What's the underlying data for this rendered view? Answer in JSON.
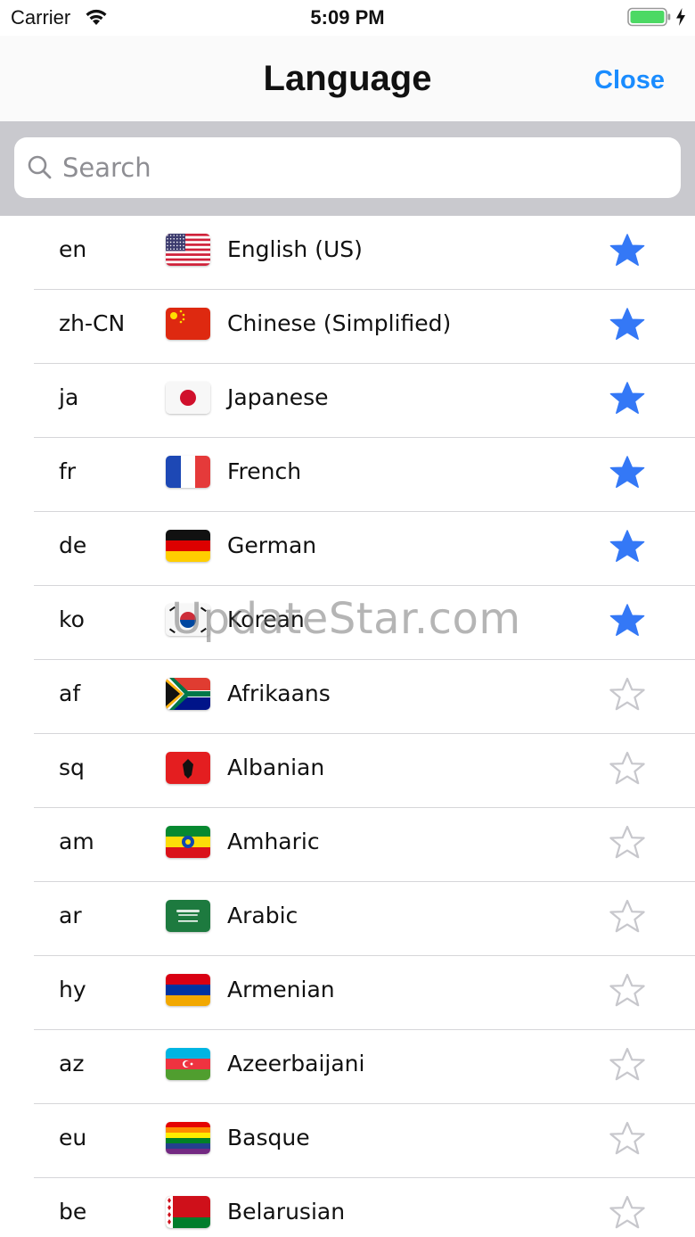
{
  "status_bar": {
    "carrier": "Carrier",
    "time": "5:09 PM",
    "battery_color": "#4cd964"
  },
  "nav": {
    "title": "Language",
    "close_label": "Close",
    "accent_color": "#1a8cff"
  },
  "search": {
    "placeholder": "Search",
    "value": ""
  },
  "star_colors": {
    "favorite": "#3478f6",
    "not_favorite": "#c7c7cc"
  },
  "languages": [
    {
      "code": "en",
      "name": "English (US)",
      "flag": "us-flag",
      "favorite": true
    },
    {
      "code": "zh-CN",
      "name": "Chinese (Simplified)",
      "flag": "cn-flag",
      "favorite": true
    },
    {
      "code": "ja",
      "name": "Japanese",
      "flag": "jp-flag",
      "favorite": true
    },
    {
      "code": "fr",
      "name": "French",
      "flag": "fr-flag",
      "favorite": true
    },
    {
      "code": "de",
      "name": "German",
      "flag": "de-flag",
      "favorite": true
    },
    {
      "code": "ko",
      "name": "Korean",
      "flag": "kr-flag",
      "favorite": true
    },
    {
      "code": "af",
      "name": "Afrikaans",
      "flag": "za-flag",
      "favorite": false
    },
    {
      "code": "sq",
      "name": "Albanian",
      "flag": "al-flag",
      "favorite": false
    },
    {
      "code": "am",
      "name": "Amharic",
      "flag": "et-flag",
      "favorite": false
    },
    {
      "code": "ar",
      "name": "Arabic",
      "flag": "sa-flag",
      "favorite": false
    },
    {
      "code": "hy",
      "name": "Armenian",
      "flag": "am-flag",
      "favorite": false
    },
    {
      "code": "az",
      "name": "Azeerbaijani",
      "flag": "az-flag",
      "favorite": false
    },
    {
      "code": "eu",
      "name": "Basque",
      "flag": "rainbow-flag",
      "favorite": false
    },
    {
      "code": "be",
      "name": "Belarusian",
      "flag": "by-flag",
      "favorite": false
    }
  ],
  "watermark": "UpdateStar.com"
}
